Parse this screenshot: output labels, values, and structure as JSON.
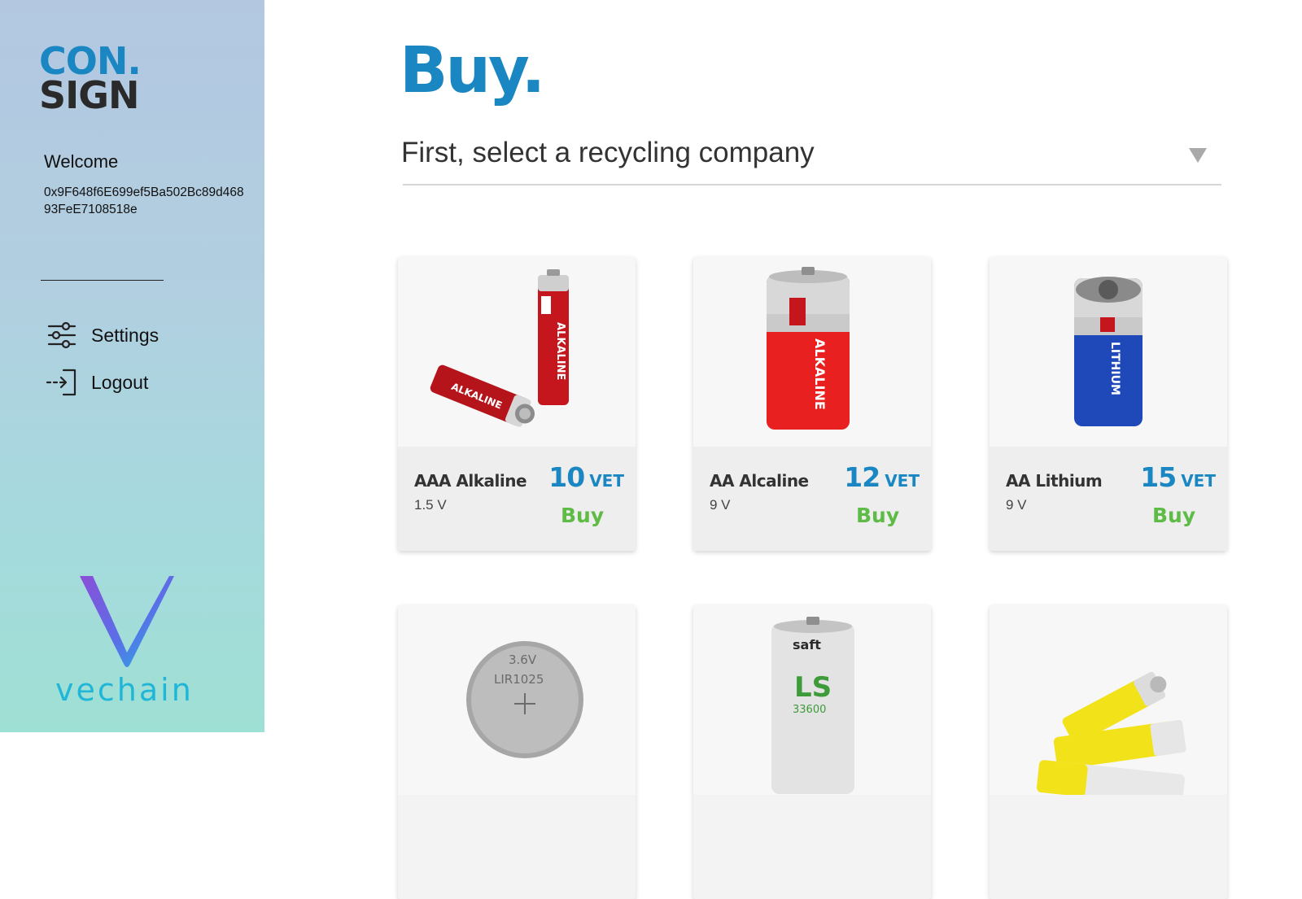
{
  "sidebar": {
    "logo_line1": "CON",
    "logo_dot": ".",
    "logo_line2": "SIGN",
    "welcome": "Welcome",
    "address": "0x9F648f6E699ef5Ba502Bc89d46893FeE7108518e",
    "nav": {
      "settings": "Settings",
      "logout": "Logout"
    },
    "brand": "vechain"
  },
  "main": {
    "title": "Buy.",
    "company_select": {
      "placeholder": "First, select a recycling company"
    },
    "products": [
      {
        "name": "AAA Alkaline",
        "spec": "1.5 V",
        "price": "10",
        "currency": "VET",
        "buy_label": "Buy",
        "icon": "aaa-alkaline-battery-icon"
      },
      {
        "name": "AA Alcaline",
        "spec": "9 V",
        "price": "12",
        "currency": "VET",
        "buy_label": "Buy",
        "icon": "d-alkaline-battery-icon"
      },
      {
        "name": "AA Lithium",
        "spec": "9 V",
        "price": "15",
        "currency": "VET",
        "buy_label": "Buy",
        "icon": "lithium-battery-icon"
      },
      {
        "icon": "coin-cell-battery-icon",
        "label_line1": "3.6V",
        "label_line2": "LIR1025"
      },
      {
        "icon": "saft-ls-battery-icon",
        "label_brand": "saft",
        "label_model": "LS",
        "label_number": "33600"
      },
      {
        "icon": "yellow-aa-batteries-icon"
      }
    ]
  },
  "colors": {
    "accent": "#1a87c2",
    "buy": "#5dbb46",
    "vechain": "#1fb6d8"
  }
}
